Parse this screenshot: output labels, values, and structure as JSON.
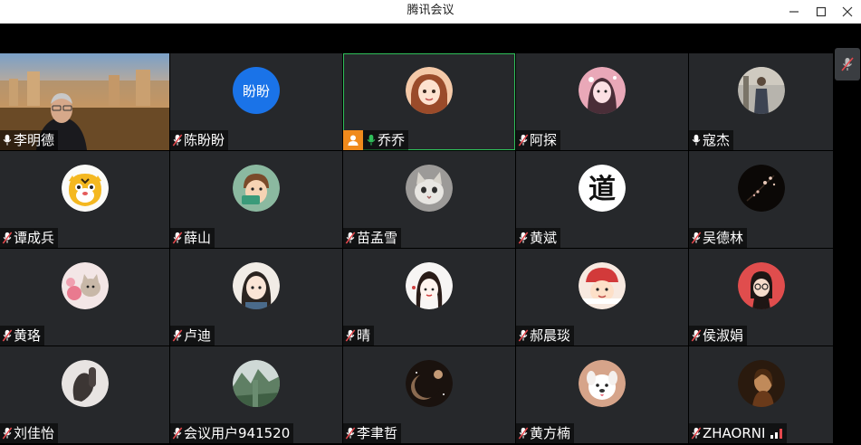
{
  "window": {
    "title": "腾讯会议",
    "controls": [
      "minimize-icon",
      "maximize-icon",
      "close-icon"
    ]
  },
  "colors": {
    "tile_bg": "#26282b",
    "active_border": "#2fbf5a",
    "muted_mic": "#e5484d",
    "speaking_mic": "#2fbf5a",
    "host_badge": "#f08a1c"
  },
  "participants": [
    {
      "name": "李明德",
      "mic": "on",
      "avatar": "video-feed"
    },
    {
      "name": "陈盼盼",
      "mic": "muted",
      "avatar": "text",
      "avatar_text": "盼盼",
      "avatar_color": "#1a73e8"
    },
    {
      "name": "乔乔",
      "mic": "speaking",
      "avatar": "illustrated-girl",
      "host": true,
      "active": true
    },
    {
      "name": "阿探",
      "mic": "muted",
      "avatar": "pink-girl"
    },
    {
      "name": "寇杰",
      "mic": "on",
      "avatar": "person-photo"
    },
    {
      "name": "谭成兵",
      "mic": "muted",
      "avatar": "tiger"
    },
    {
      "name": "薛山",
      "mic": "muted",
      "avatar": "cartoon-boy"
    },
    {
      "name": "苗孟雪",
      "mic": "muted",
      "avatar": "cat"
    },
    {
      "name": "黄斌",
      "mic": "muted",
      "avatar": "calligraphy",
      "avatar_text": "道"
    },
    {
      "name": "吴德林",
      "mic": "muted",
      "avatar": "dark-blossom"
    },
    {
      "name": "黄珞",
      "mic": "muted",
      "avatar": "flower-cat"
    },
    {
      "name": "卢迪",
      "mic": "muted",
      "avatar": "anime-girl"
    },
    {
      "name": "晴",
      "mic": "muted",
      "avatar": "sketch-girl"
    },
    {
      "name": "郝晨琰",
      "mic": "muted",
      "avatar": "red-hat-girl"
    },
    {
      "name": "侯淑娟",
      "mic": "muted",
      "avatar": "red-glasses"
    },
    {
      "name": "刘佳怡",
      "mic": "muted",
      "avatar": "hand-photo"
    },
    {
      "name": "会议用户941520",
      "mic": "muted",
      "avatar": "landscape"
    },
    {
      "name": "李聿哲",
      "mic": "muted",
      "avatar": "space-moon"
    },
    {
      "name": "黄方楠",
      "mic": "muted",
      "avatar": "white-dog"
    },
    {
      "name": "ZHAORNI",
      "mic": "muted",
      "avatar": "woman-photo",
      "signal": true
    }
  ],
  "side_panel": {
    "icon": "muted-mic-icon"
  }
}
